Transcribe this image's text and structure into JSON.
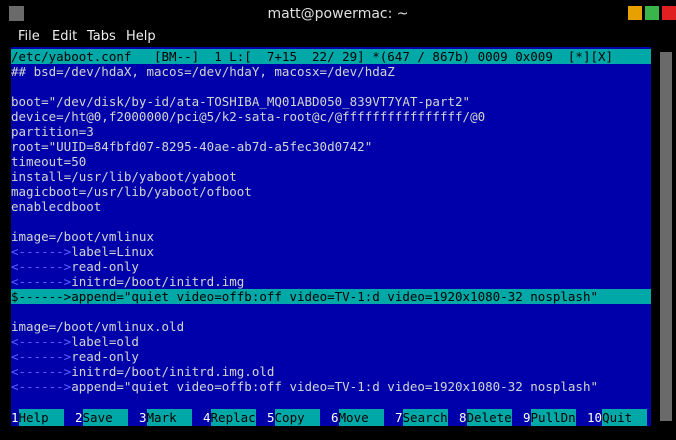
{
  "window": {
    "title": "matt@powermac: ~"
  },
  "menu": [
    "File",
    "Edit",
    "Tabs",
    "Help"
  ],
  "status_line": "/etc/yaboot.conf   [BM--]  1 L:[  7+15  22/ 29] *(647 / 867b) 0009 0x009  [*][X]",
  "tab_marker": "<------>",
  "cursor_char": "$",
  "lines": [
    {
      "tab": false,
      "text": "## bsd=/dev/hdaX, macos=/dev/hdaY, macosx=/dev/hdaZ"
    },
    {
      "tab": false,
      "text": ""
    },
    {
      "tab": false,
      "text": "boot=\"/dev/disk/by-id/ata-TOSHIBA_MQ01ABD050_839VT7YAT-part2\""
    },
    {
      "tab": false,
      "text": "device=/ht@0,f2000000/pci@5/k2-sata-root@c/@ffffffffffffffff/@0"
    },
    {
      "tab": false,
      "text": "partition=3"
    },
    {
      "tab": false,
      "text": "root=\"UUID=84fbfd07-8295-40ae-ab7d-a5fec30d0742\""
    },
    {
      "tab": false,
      "text": "timeout=50"
    },
    {
      "tab": false,
      "text": "install=/usr/lib/yaboot/yaboot"
    },
    {
      "tab": false,
      "text": "magicboot=/usr/lib/yaboot/ofboot"
    },
    {
      "tab": false,
      "text": "enablecdboot"
    },
    {
      "tab": false,
      "text": ""
    },
    {
      "tab": false,
      "text": "image=/boot/vmlinux"
    },
    {
      "tab": true,
      "text": "label=Linux"
    },
    {
      "tab": true,
      "text": "read-only"
    },
    {
      "tab": true,
      "text": "initrd=/boot/initrd.img"
    },
    {
      "tab": true,
      "cursor": true,
      "highlight": true,
      "text": "append=\"quiet video=offb:off video=TV-1:d video=1920x1080-32 nosplash\""
    },
    {
      "tab": false,
      "text": ""
    },
    {
      "tab": false,
      "text": "image=/boot/vmlinux.old"
    },
    {
      "tab": true,
      "text": "label=old"
    },
    {
      "tab": true,
      "text": "read-only"
    },
    {
      "tab": true,
      "text": "initrd=/boot/initrd.img.old"
    },
    {
      "tab": true,
      "text": "append=\"quiet video=offb:off video=TV-1:d video=1920x1080-32 nosplash\""
    }
  ],
  "fkeys": [
    {
      "num": "1",
      "label": "Help  "
    },
    {
      "num": "2",
      "label": "Save  "
    },
    {
      "num": "3",
      "label": "Mark  "
    },
    {
      "num": "4",
      "label": "Replac"
    },
    {
      "num": "5",
      "label": "Copy  "
    },
    {
      "num": "6",
      "label": "Move  "
    },
    {
      "num": "7",
      "label": "Search"
    },
    {
      "num": "8",
      "label": "Delete"
    },
    {
      "num": "9",
      "label": "PullDn"
    },
    {
      "num": "10",
      "label": "Quit  "
    }
  ]
}
